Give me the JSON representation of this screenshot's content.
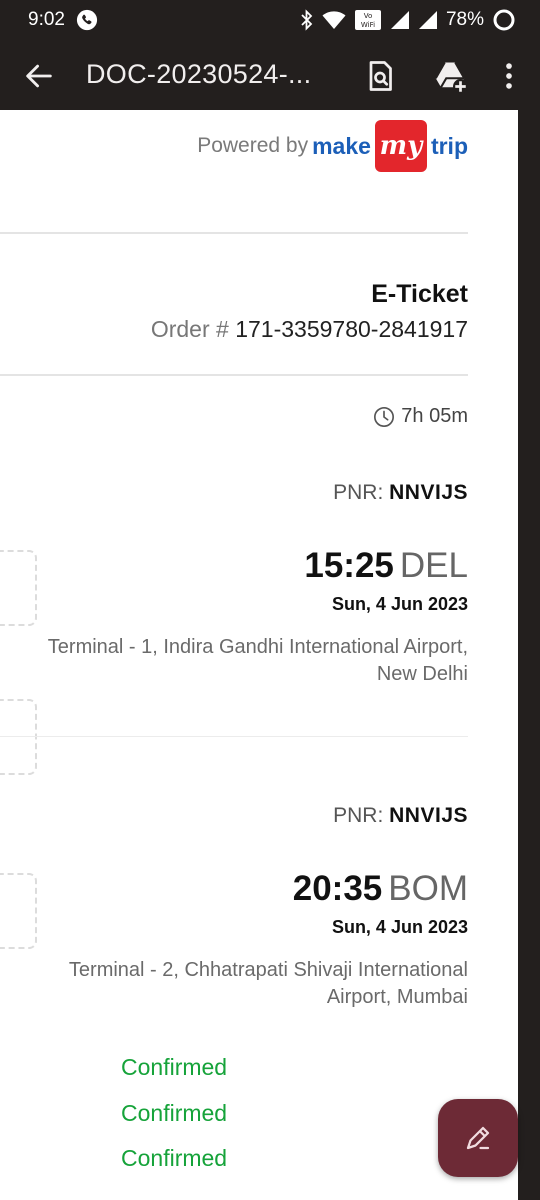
{
  "status_bar": {
    "time": "9:02",
    "battery": "78%"
  },
  "app_bar": {
    "title": "DOC-20230524-..."
  },
  "branding": {
    "powered_by": "Powered by",
    "brand_make": "make",
    "brand_my": "my",
    "brand_trip": "trip"
  },
  "ticket": {
    "title": "E-Ticket",
    "order_label": "Order #",
    "order_number": "171-3359780-2841917",
    "duration": "7h 05m"
  },
  "segments": [
    {
      "pnr_label": "PNR:",
      "pnr": "NNVIJS",
      "time": "15:25",
      "code": "DEL",
      "date": "Sun, 4 Jun 2023",
      "terminal": "Terminal - 1, Indira Gandhi International Airport, New Delhi"
    },
    {
      "pnr_label": "PNR:",
      "pnr": "NNVIJS",
      "time": "20:35",
      "code": "BOM",
      "date": "Sun, 4 Jun 2023",
      "terminal": "Terminal - 2, Chhatrapati Shivaji International Airport, Mumbai"
    }
  ],
  "passenger_statuses": [
    "Confirmed",
    "Confirmed",
    "Confirmed"
  ],
  "colors": {
    "confirmed": "#16a33a",
    "fab": "#6d2a36",
    "brand_blue": "#1c5fb8",
    "brand_red": "#e3262c"
  }
}
